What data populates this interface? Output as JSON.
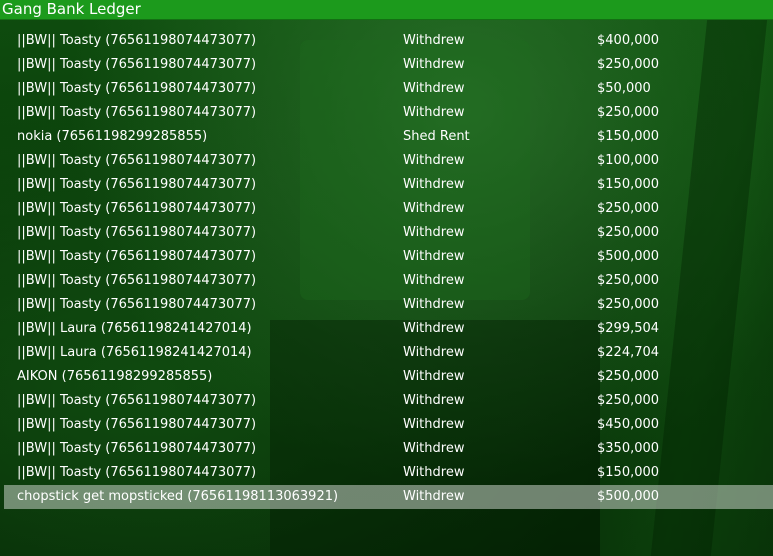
{
  "window": {
    "title": "Gang Bank Ledger"
  },
  "ledger": {
    "rows": [
      {
        "name": "||BW|| Toasty (76561198074473077)",
        "action": "Withdrew",
        "amount": "$400,000"
      },
      {
        "name": "||BW|| Toasty (76561198074473077)",
        "action": "Withdrew",
        "amount": "$250,000"
      },
      {
        "name": "||BW|| Toasty (76561198074473077)",
        "action": "Withdrew",
        "amount": "$50,000"
      },
      {
        "name": "||BW|| Toasty (76561198074473077)",
        "action": "Withdrew",
        "amount": "$250,000"
      },
      {
        "name": "nokia (76561198299285855)",
        "action": "Shed Rent",
        "amount": "$150,000"
      },
      {
        "name": "||BW|| Toasty (76561198074473077)",
        "action": "Withdrew",
        "amount": "$100,000"
      },
      {
        "name": "||BW|| Toasty (76561198074473077)",
        "action": "Withdrew",
        "amount": "$150,000"
      },
      {
        "name": "||BW|| Toasty (76561198074473077)",
        "action": "Withdrew",
        "amount": "$250,000"
      },
      {
        "name": "||BW|| Toasty (76561198074473077)",
        "action": "Withdrew",
        "amount": "$250,000"
      },
      {
        "name": "||BW|| Toasty (76561198074473077)",
        "action": "Withdrew",
        "amount": "$500,000"
      },
      {
        "name": "||BW|| Toasty (76561198074473077)",
        "action": "Withdrew",
        "amount": "$250,000"
      },
      {
        "name": "||BW|| Toasty (76561198074473077)",
        "action": "Withdrew",
        "amount": "$250,000"
      },
      {
        "name": "||BW|| Laura (76561198241427014)",
        "action": "Withdrew",
        "amount": "$299,504"
      },
      {
        "name": "||BW|| Laura (76561198241427014)",
        "action": "Withdrew",
        "amount": "$224,704"
      },
      {
        "name": "AIKON (76561198299285855)",
        "action": "Withdrew",
        "amount": "$250,000"
      },
      {
        "name": "||BW|| Toasty (76561198074473077)",
        "action": "Withdrew",
        "amount": "$250,000"
      },
      {
        "name": "||BW|| Toasty (76561198074473077)",
        "action": "Withdrew",
        "amount": "$450,000"
      },
      {
        "name": "||BW|| Toasty (76561198074473077)",
        "action": "Withdrew",
        "amount": "$350,000"
      },
      {
        "name": "||BW|| Toasty (76561198074473077)",
        "action": "Withdrew",
        "amount": "$150,000"
      },
      {
        "name": "chopstick get mopsticked (76561198113063921)",
        "action": "Withdrew",
        "amount": "$500,000"
      }
    ]
  },
  "colors": {
    "titlebar": "#1c9a1c",
    "text": "#ffffff",
    "selected_row": "#c8d2c8"
  }
}
